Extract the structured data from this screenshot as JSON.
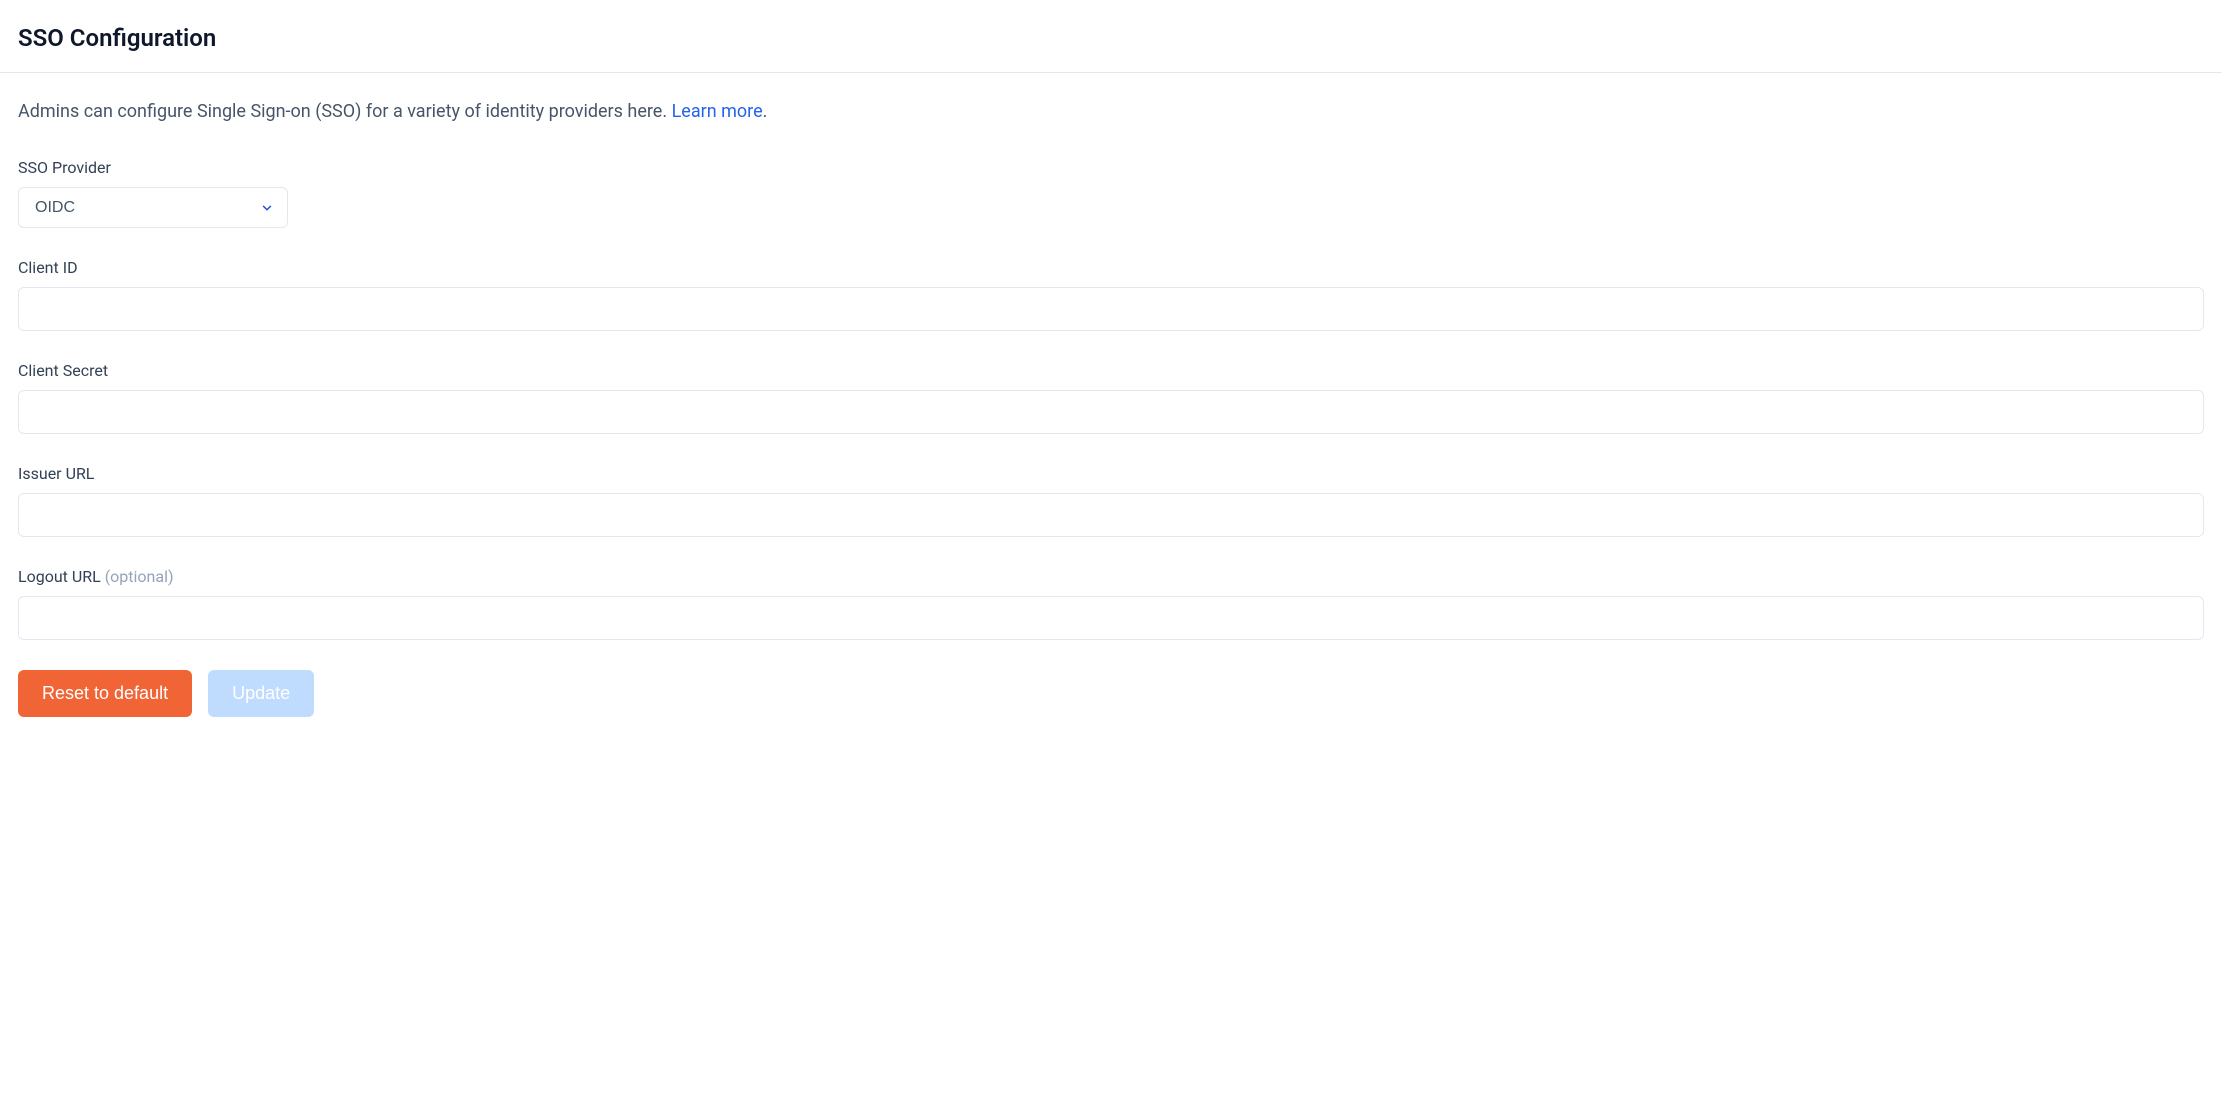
{
  "header": {
    "title": "SSO Configuration"
  },
  "description": {
    "text": "Admins can configure Single Sign-on (SSO) for a variety of identity providers here. ",
    "link_text": "Learn more",
    "suffix": "."
  },
  "form": {
    "provider": {
      "label": "SSO Provider",
      "selected": "OIDC"
    },
    "client_id": {
      "label": "Client ID",
      "value": ""
    },
    "client_secret": {
      "label": "Client Secret",
      "value": ""
    },
    "issuer_url": {
      "label": "Issuer URL",
      "value": ""
    },
    "logout_url": {
      "label": "Logout URL ",
      "optional": "(optional)",
      "value": ""
    }
  },
  "buttons": {
    "reset": "Reset to default",
    "update": "Update"
  }
}
